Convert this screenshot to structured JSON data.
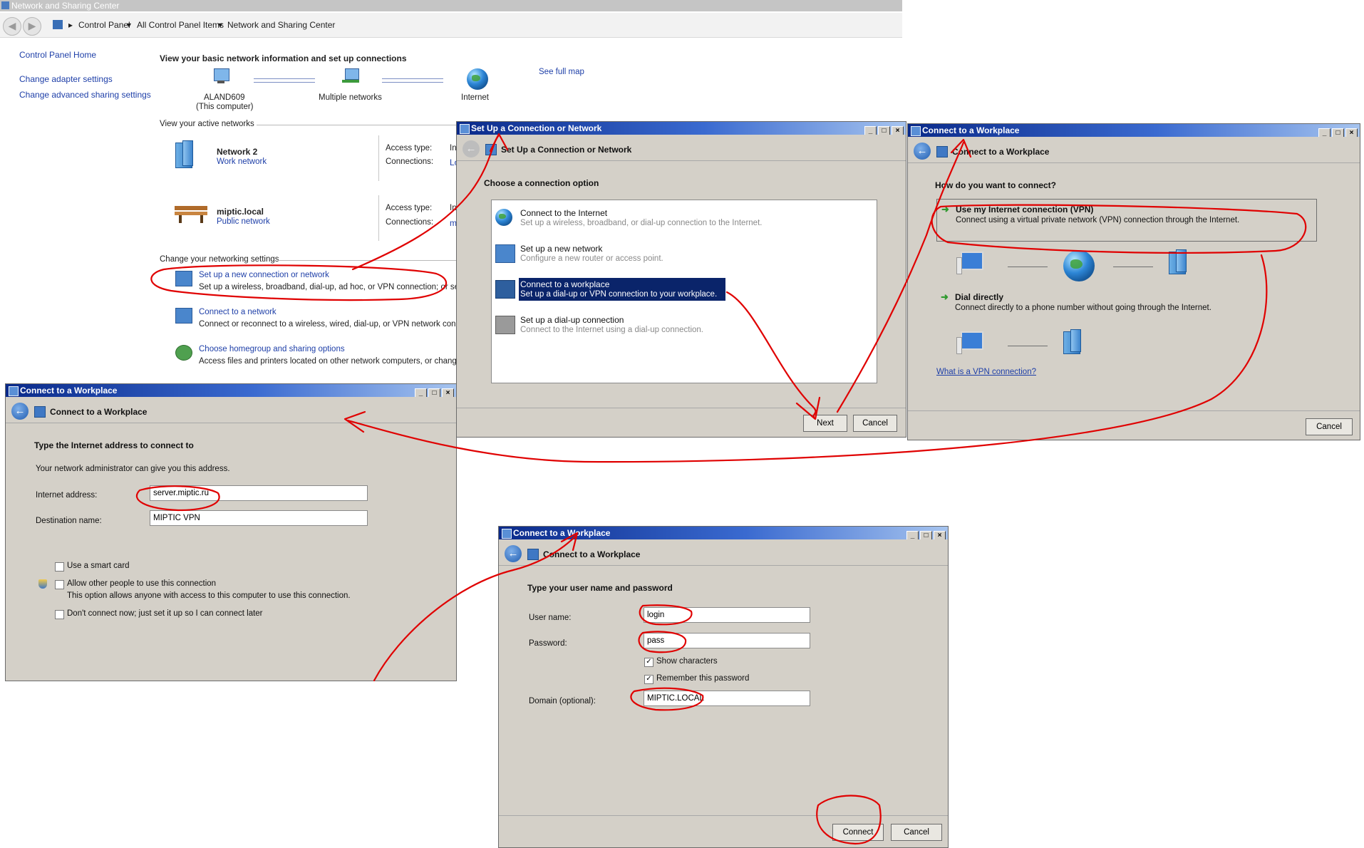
{
  "nsc": {
    "title": "Network and Sharing Center",
    "breadcrumb": [
      "Control Panel",
      "All Control Panel Items",
      "Network and Sharing Center"
    ],
    "left_links": [
      "Control Panel Home",
      "Change adapter settings",
      "Change advanced sharing settings"
    ],
    "heading": "View your basic network information and set up connections",
    "see_full_map": "See full map",
    "map": {
      "computer": "ALAND609",
      "computer_sub": "(This computer)",
      "middle": "Multiple networks",
      "internet": "Internet"
    },
    "active_networks_label": "View your active networks",
    "networks": [
      {
        "name": "Network  2",
        "type": "Work network",
        "access_label": "Access type:",
        "access_value": "In",
        "conn_label": "Connections:",
        "conn_value": "Lo"
      },
      {
        "name": "miptic.local",
        "type": "Public network",
        "access_label": "Access type:",
        "access_value": "In",
        "conn_label": "Connections:",
        "conn_value": "m"
      }
    ],
    "change_settings_label": "Change your networking settings",
    "tasks": [
      {
        "title": "Set up a new connection or network",
        "desc": "Set up a wireless, broadband, dial-up, ad hoc, or VPN connection; or set u"
      },
      {
        "title": "Connect to a network",
        "desc": "Connect or reconnect to a wireless, wired, dial-up, or VPN network conne"
      },
      {
        "title": "Choose homegroup and sharing options",
        "desc": "Access files and printers located on other network computers, or change s"
      }
    ]
  },
  "setup": {
    "title": "Set Up a Connection or Network",
    "header": "Set Up a Connection or Network",
    "prompt": "Choose a connection option",
    "options": [
      {
        "title": "Connect to the Internet",
        "desc": "Set up a wireless, broadband, or dial-up connection to the Internet."
      },
      {
        "title": "Set up a new network",
        "desc": "Configure a new router or access point."
      },
      {
        "title": "Connect to a workplace",
        "desc": "Set up a dial-up or VPN connection to your workplace."
      },
      {
        "title": "Set up a dial-up connection",
        "desc": "Connect to the Internet using a dial-up connection."
      }
    ],
    "next": "Next",
    "cancel": "Cancel"
  },
  "how": {
    "title": "Connect to a Workplace",
    "header": "Connect to a Workplace",
    "prompt": "How do you want to connect?",
    "vpn_title": "Use my Internet connection (VPN)",
    "vpn_desc": "Connect using a virtual private network (VPN) connection through the Internet.",
    "dial_title": "Dial directly",
    "dial_desc": "Connect directly to a phone number without going through the Internet.",
    "link": "What is a VPN connection?",
    "cancel": "Cancel"
  },
  "address": {
    "title": "Connect to a Workplace",
    "header": "Connect to a Workplace",
    "prompt": "Type the Internet address to connect to",
    "note": "Your network administrator can give you this address.",
    "internet_label": "Internet address:",
    "internet_value": "server.miptic.ru",
    "dest_label": "Destination name:",
    "dest_value": "MIPTIC VPN",
    "smart_card": "Use a smart card",
    "allow_others": "Allow other people to use this connection",
    "allow_note": "This option allows anyone with access to this computer to use this connection.",
    "dont_connect": "Don't connect now; just set it up so I can connect later"
  },
  "creds": {
    "title": "Connect to a Workplace",
    "header": "Connect to a Workplace",
    "prompt": "Type your user name and password",
    "user_label": "User name:",
    "user_value": "login",
    "pass_label": "Password:",
    "pass_value": "pass",
    "show_chars": "Show characters",
    "remember": "Remember this password",
    "domain_label": "Domain (optional):",
    "domain_value": "MIPTIC.LOCAL",
    "connect": "Connect",
    "cancel": "Cancel"
  },
  "colors": {
    "titlebar": "#0a246a",
    "annotation": "#e00000",
    "link": "#1e3fa8",
    "dialog_bg": "#d4d0c8"
  },
  "icons": [
    "back-arrow-icon",
    "globe-icon",
    "computer-icon",
    "building-icon",
    "bench-icon",
    "checkbox-icon",
    "shield-icon",
    "green-arrow-icon"
  ]
}
